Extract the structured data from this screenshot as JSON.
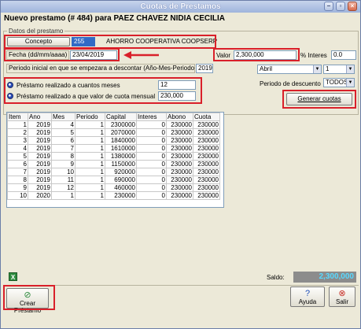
{
  "window": {
    "title": "Cuotas de Prestamos",
    "header": "Nuevo prestamo (# 484) para PAEZ CHAVEZ NIDIA CECILIA",
    "group_label": "Datos del prestamo"
  },
  "form": {
    "concepto_label": "Concepto",
    "concepto_code": "255",
    "concepto_name": "AHORRO COOPERATIVA COOPSERP",
    "fecha_label": "Fecha (dd/mm/aaaa)",
    "fecha_value": "23/04/2019",
    "valor_label": "Valor",
    "valor_value": "2,300,000",
    "interes_label": "% Interes",
    "interes_value": "0.0",
    "periodo_label": "Periodo inicial en que se empezara a descontar (Año-Mes-Periodo)",
    "periodo_year": "2019",
    "periodo_month": "Abril",
    "periodo_num": "1",
    "radio1_label": "Préstamo realizado a cuantos meses",
    "radio1_value": "12",
    "radio2_label": "Préstamo realizado a que valor de cuota mensual",
    "radio2_value": "230,000",
    "desc_label": "Periodo de descuento",
    "desc_value": "TODOS",
    "generar_label": "Generar cuotas"
  },
  "table": {
    "headers": [
      "Item",
      "Ano",
      "Mes",
      "Periodo",
      "Capital",
      "Interes",
      "Abono",
      "Cuota"
    ],
    "rows": [
      [
        "1",
        "2019",
        "4",
        "1",
        "2300000",
        "0",
        "230000",
        "230000"
      ],
      [
        "2",
        "2019",
        "5",
        "1",
        "2070000",
        "0",
        "230000",
        "230000"
      ],
      [
        "3",
        "2019",
        "6",
        "1",
        "1840000",
        "0",
        "230000",
        "230000"
      ],
      [
        "4",
        "2019",
        "7",
        "1",
        "1610000",
        "0",
        "230000",
        "230000"
      ],
      [
        "5",
        "2019",
        "8",
        "1",
        "1380000",
        "0",
        "230000",
        "230000"
      ],
      [
        "6",
        "2019",
        "9",
        "1",
        "1150000",
        "0",
        "230000",
        "230000"
      ],
      [
        "7",
        "2019",
        "10",
        "1",
        "920000",
        "0",
        "230000",
        "230000"
      ],
      [
        "8",
        "2019",
        "11",
        "1",
        "690000",
        "0",
        "230000",
        "230000"
      ],
      [
        "9",
        "2019",
        "12",
        "1",
        "460000",
        "0",
        "230000",
        "230000"
      ],
      [
        "10",
        "2020",
        "1",
        "1",
        "230000",
        "0",
        "230000",
        "230000"
      ]
    ]
  },
  "footer": {
    "saldo_label": "Saldo:",
    "saldo_value": "2,300,000",
    "crear_label": "Crear Préstamo",
    "ayuda_label": "Ayuda",
    "salir_label": "Salir",
    "excel_icon": "excel-icon"
  },
  "colors": {
    "highlight_red": "#d9202a",
    "saldo_text": "#57d9ff"
  }
}
